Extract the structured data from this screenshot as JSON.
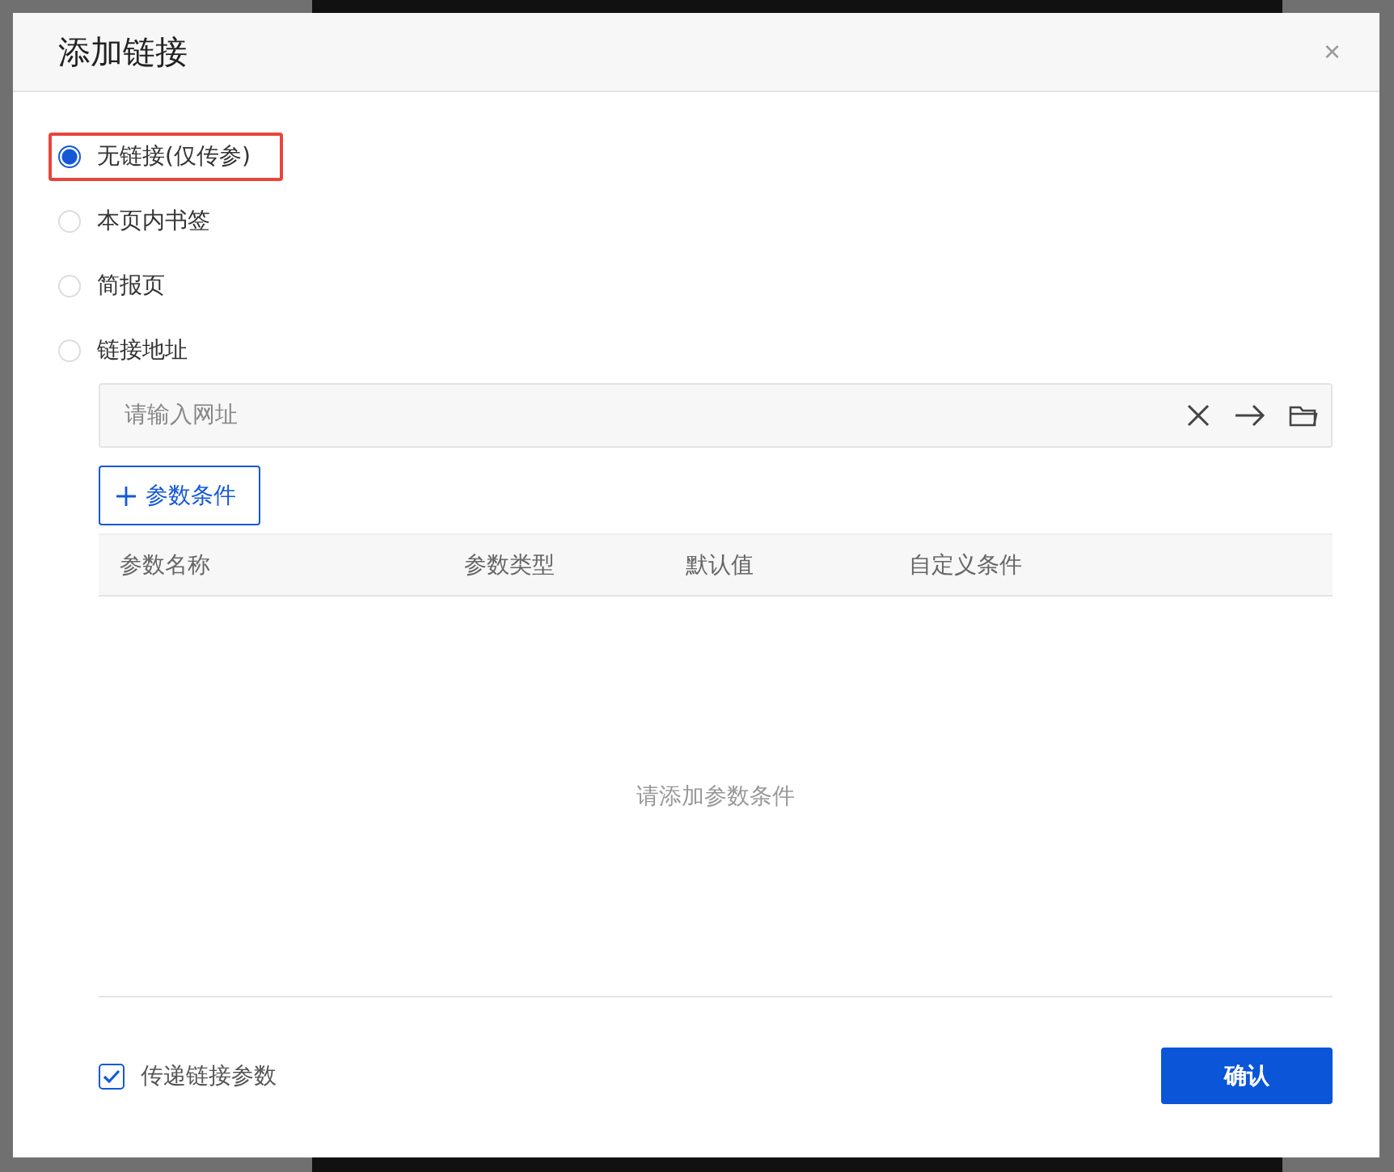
{
  "dialog": {
    "title": "添加链接",
    "close": "×"
  },
  "options": [
    {
      "label": "无链接(仅传参)",
      "selected": true,
      "highlighted": true
    },
    {
      "label": "本页内书签",
      "selected": false,
      "highlighted": false
    },
    {
      "label": "简报页",
      "selected": false,
      "highlighted": false
    },
    {
      "label": "链接地址",
      "selected": false,
      "highlighted": false
    }
  ],
  "url_field": {
    "placeholder": "请输入网址"
  },
  "add_button": {
    "label": "参数条件"
  },
  "table": {
    "columns": [
      "参数名称",
      "参数类型",
      "默认值",
      "自定义条件"
    ],
    "empty_text": "请添加参数条件"
  },
  "footer": {
    "checkbox": {
      "label": "传递链接参数",
      "checked": true
    },
    "confirm": "确认"
  }
}
